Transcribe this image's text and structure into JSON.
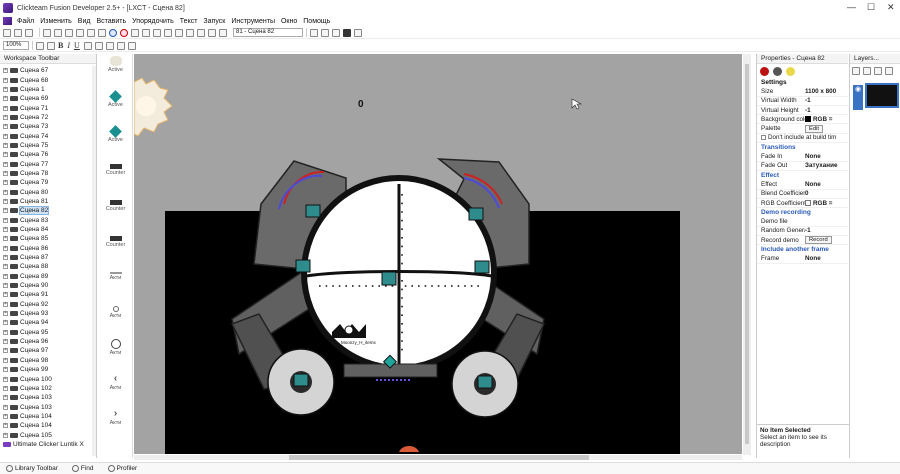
{
  "window": {
    "title": "Clickteam Fusion Developer 2.5+ - [LXCT - Сцена 82]",
    "minimize": "—",
    "maximize": "☐",
    "close": "✕"
  },
  "menu": [
    "Файл",
    "Изменить",
    "Вид",
    "Вставить",
    "Упорядочить",
    "Текст",
    "Запуск",
    "Инструменты",
    "Окно",
    "Помощь"
  ],
  "toolbar": {
    "frame_select": "81 - Сцена 82",
    "zoom": "100%",
    "bold": "B",
    "italic": "I",
    "underline": "U"
  },
  "workspace": {
    "title": "Workspace Toolbar",
    "items": [
      "Сцена 67",
      "Сцена 68",
      "Сцена 1",
      "Сцена 69",
      "Сцена 71",
      "Сцена 72",
      "Сцена 73",
      "Сцена 74",
      "Сцена 75",
      "Сцена 76",
      "Сцена 77",
      "Сцена 78",
      "Сцена 79",
      "Сцена 80",
      "Сцена 81",
      "Сцена 82",
      "Сцена 83",
      "Сцена 84",
      "Сцена 85",
      "Сцена 86",
      "Сцена 87",
      "Сцена 88",
      "Сцена 89",
      "Сцена 90",
      "Сцена 91",
      "Сцена 92",
      "Сцена 93",
      "Сцена 94",
      "Сцена 95",
      "Сцена 96",
      "Сцена 97",
      "Сцена 98",
      "Сцена 99",
      "Сцена 100",
      "Сцена 102",
      "Сцена 103",
      "Сцена 103",
      "Сцена 104",
      "Сцена 104",
      "Сцена 105"
    ],
    "selected_index": 15,
    "app_item": "Ultimate Clicker Luntik X"
  },
  "palette": {
    "items": [
      "Active",
      "Active",
      "Active",
      "Counter",
      "Counter",
      "Counter",
      "Акти",
      "Акти",
      "Акти",
      "Акти",
      "Акти"
    ]
  },
  "editor": {
    "score_text": "0",
    "logo_text": "Moonzy_H_items"
  },
  "properties": {
    "title": "Properties - Сцена 82",
    "sections": {
      "settings": "Settings",
      "transitions": "Transitions",
      "effect": "Effect",
      "demo": "Demo recording",
      "include": "Include another frame"
    },
    "size": {
      "k": "Size",
      "v": "1100 x 800"
    },
    "virtual_width": {
      "k": "Virtual Width",
      "v": "-1"
    },
    "virtual_height": {
      "k": "Virtual Height",
      "v": "-1"
    },
    "bg_color": {
      "k": "Background colo",
      "v": "RGB ="
    },
    "palette": {
      "k": "Palette",
      "v": "Edit"
    },
    "dont_include": "Don't include at build tim",
    "fade_in": {
      "k": "Fade In",
      "v": "None"
    },
    "fade_out": {
      "k": "Fade Out",
      "v": "Затухание"
    },
    "effect": {
      "k": "Effect",
      "v": "None"
    },
    "blend": {
      "k": "Blend Coefficient",
      "v": "0"
    },
    "rgb": {
      "k": "RGB Coefficient",
      "v": "RGB ="
    },
    "demo_file": {
      "k": "Demo file",
      "v": ""
    },
    "random": {
      "k": "Random Generat",
      "v": "-1"
    },
    "record": {
      "k": "Record demo",
      "v": "Record"
    },
    "frame": {
      "k": "Frame",
      "v": "None"
    },
    "info_title": "No Item Selected",
    "info_desc": "Select an item to see its description"
  },
  "layers": {
    "title": "Layers..."
  },
  "bottom": {
    "library": "Library Toolbar",
    "find": "Find",
    "profiler": "Profiler"
  }
}
